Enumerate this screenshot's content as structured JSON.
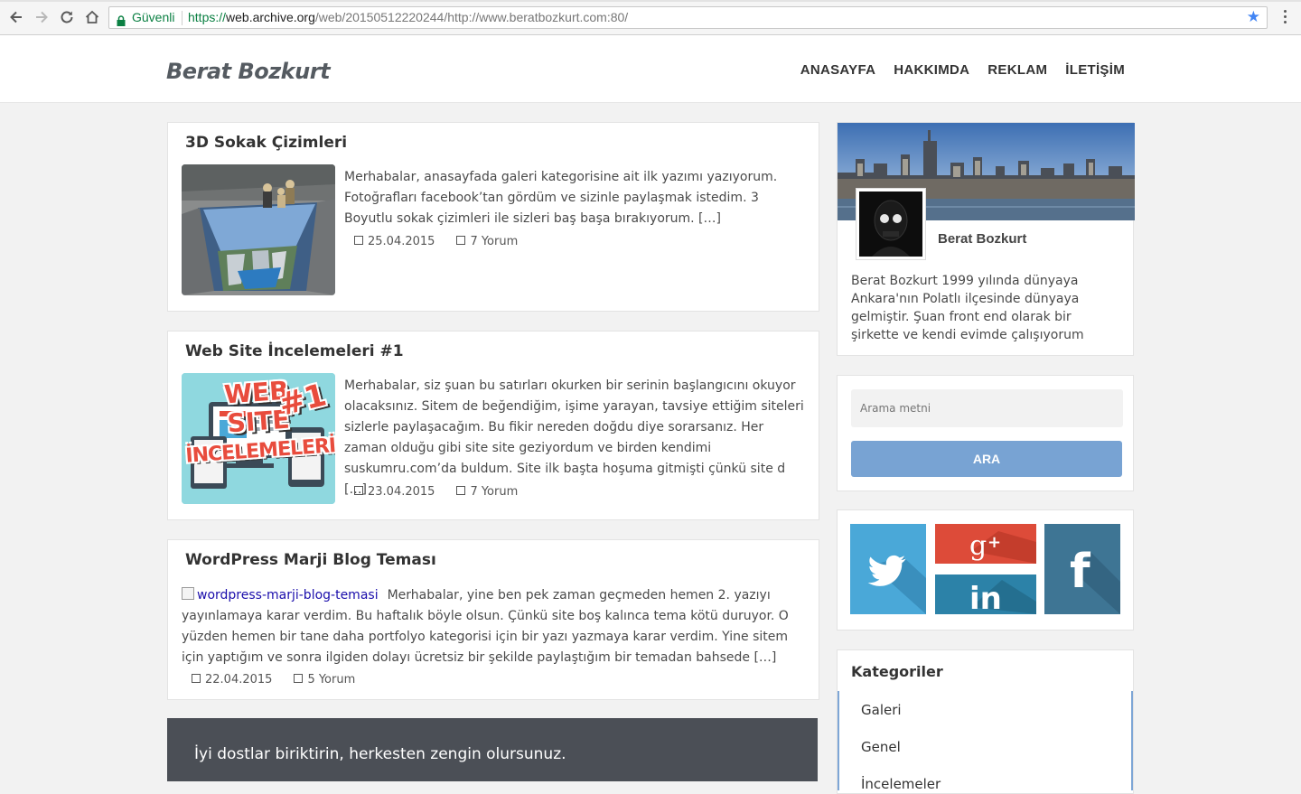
{
  "browser": {
    "secure_label": "Güvenli",
    "url_scheme": "https://",
    "url_host": "web.archive.org",
    "url_path": "/web/20150512220244/http://www.beratbozkurt.com:80/"
  },
  "site": {
    "brand": "Berat Bozkurt",
    "menu": [
      "ANASAYFA",
      "HAKKIMDA",
      "REKLAM",
      "İLETİŞİM"
    ]
  },
  "posts": [
    {
      "title": "3D Sokak Çizimleri",
      "excerpt": "Merhabalar, anasayfada galeri kategorisine ait ilk yazımı yazıyorum. Fotoğrafları facebook’tan gördüm ve sizinle paylaşmak istedim. 3 Boyutlu sokak çizimleri ile sizleri baş başa bırakıyorum.    […]",
      "date": "25.04.2015",
      "comments": "7 Yorum"
    },
    {
      "title": "Web Site İncelemeleri #1",
      "excerpt": "Merhabalar, siz şuan bu satırları okurken bir serinin başlangıcını okuyor olacaksınız. Sitem de beğendiğim, işime yarayan, tavsiye ettiğim siteleri sizlerle paylaşacağım. Bu fikir nereden doğdu diye sorarsanız. Her zaman olduğu gibi site site geziyordum ve birden kendimi suskumru.com’da buldum. Site ilk başta hoşuma gitmişti çünkü site d […]",
      "date": "23.04.2015",
      "comments": "7 Yorum",
      "thumb_lines": [
        "WEB",
        "SITE",
        "İNCELEMELERİ",
        "#1"
      ]
    },
    {
      "title": "WordPress Marji Blog Teması",
      "image_alt": "wordpress-marji-blog-temasi",
      "excerpt": "Merhabalar, yine ben pek zaman geçmeden hemen 2. yazıyı yayınlamaya karar verdim. Bu haftalık böyle olsun. Çünkü site boş kalınca tema kötü duruyor. O yüzden hemen bir tane daha portfolyo kategorisi için bir yazı yazmaya karar verdim.   Yine sitem için yaptığım ve sonra ilgiden dolayı ücretsiz bir şekilde paylaştığım bir temadan bahsede […]",
      "date": "22.04.2015",
      "comments": "5 Yorum"
    }
  ],
  "quote": "İyi dostlar biriktirin, herkesten zengin olursunuz.",
  "profile": {
    "name": "Berat Bozkurt",
    "bio": "Berat Bozkurt 1999 yılında dünyaya Ankara'nın Polatlı ilçesinde dünyaya gelmiştir. Şuan front end olarak bir şirkette ve kendi evimde çalışıyorum"
  },
  "search": {
    "placeholder": "Arama metni",
    "button": "ARA"
  },
  "social": {
    "twitter_color": "#4aa8d8",
    "google_color": "#dd4b39",
    "linkedin_color": "#2c82a8",
    "facebook_color": "#3e7594"
  },
  "categories": {
    "title": "Kategoriler",
    "items": [
      "Galeri",
      "Genel",
      "İncelemeler"
    ]
  }
}
